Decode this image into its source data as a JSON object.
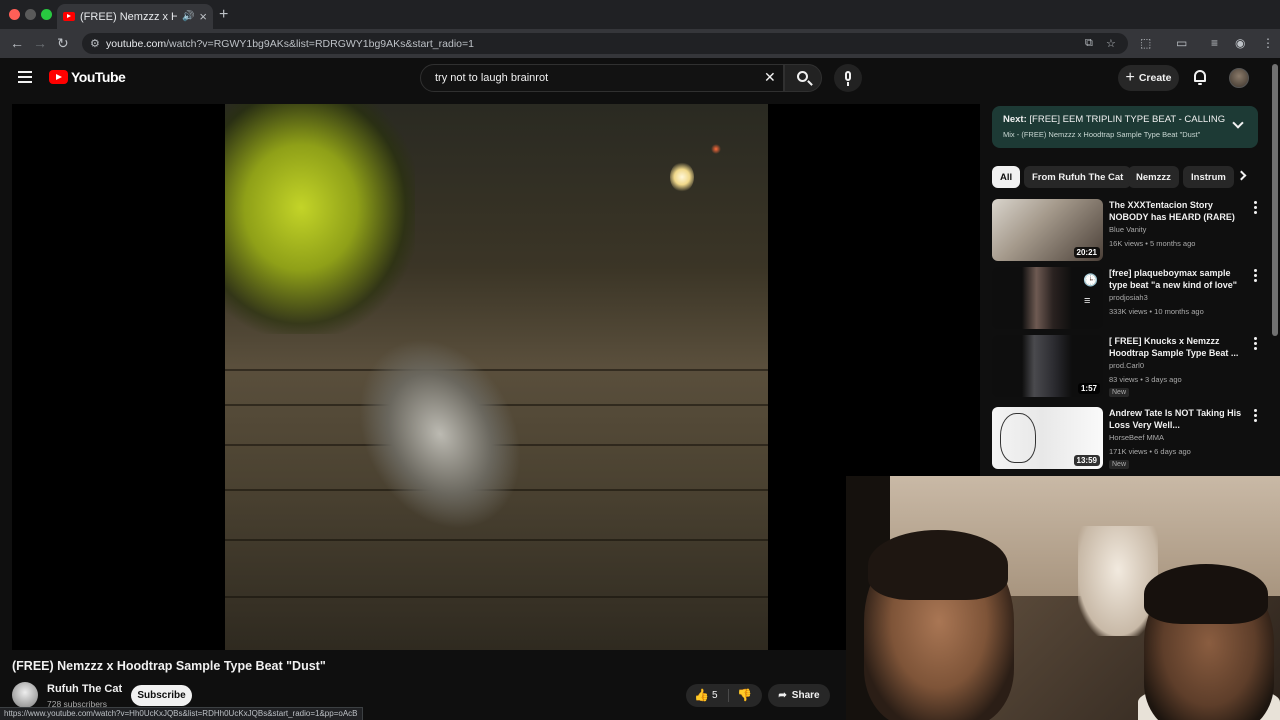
{
  "browser": {
    "tab_title": "(FREE) Nemzzz x Hoodtrap Sample Type Beat \"Dust\" - YouTube",
    "url_host": "youtube.com",
    "url_path": "/watch?v=RGWY1bg9AKs&list=RDRGWY1bg9AKs&start_radio=1",
    "status_url": "https://www.youtube.com/watch?v=Hh0UcKxJQBs&list=RDHh0UcKxJQBs&start_radio=1&pp=oAcB",
    "new_tab_glyph": "+",
    "close_glyph": "×",
    "audio_glyph": "🔊"
  },
  "header": {
    "logo_text": "YouTube",
    "search_value": "try not to laugh brainrot",
    "clear_glyph": "✕",
    "create_label": "Create",
    "create_glyph": "+"
  },
  "video": {
    "title": "(FREE) Nemzzz x Hoodtrap Sample Type Beat \"Dust\"",
    "channel": "Rufuh The Cat",
    "subscribers": "728 subscribers",
    "subscribe_label": "Subscribe",
    "likes": "5",
    "share_label": "Share"
  },
  "up_next": {
    "prefix": "Next:",
    "title": "[FREE] EEM TRIPLIN TYPE BEAT - CALLING",
    "mix": "Mix - (FREE) Nemzzz x Hoodtrap Sample Type Beat \"Dust\""
  },
  "chips": [
    "All",
    "From Rufuh The Cat",
    "Nemzzz",
    "Instrum"
  ],
  "recommendations": [
    {
      "title": "The XXXTentacion Story NOBODY has HEARD (RARE)",
      "channel": "Blue Vanity",
      "meta": "16K views • 5 months ago",
      "duration": "20:21",
      "badge": ""
    },
    {
      "title": "[free] plaqueboymax sample type beat \"a new kind of love\" ...",
      "channel": "prodjosiah3",
      "meta": "333K views • 10 months ago",
      "duration": "",
      "badge": ""
    },
    {
      "title": "[ FREE] Knucks x Nemzzz Hoodtrap Sample Type Beat ...",
      "channel": "prod.Carl0",
      "meta": "83 views • 3 days ago",
      "duration": "1:57",
      "badge": "New"
    },
    {
      "title": "Andrew Tate Is NOT Taking His Loss Very Well...",
      "channel": "HorseBeef MMA",
      "meta": "171K views • 6 days ago",
      "duration": "13:59",
      "badge": "New"
    }
  ],
  "colors": {
    "youtube_red": "#ff0000",
    "up_next_bg": "#1d3a35",
    "page_bg": "#0f0f0f"
  }
}
